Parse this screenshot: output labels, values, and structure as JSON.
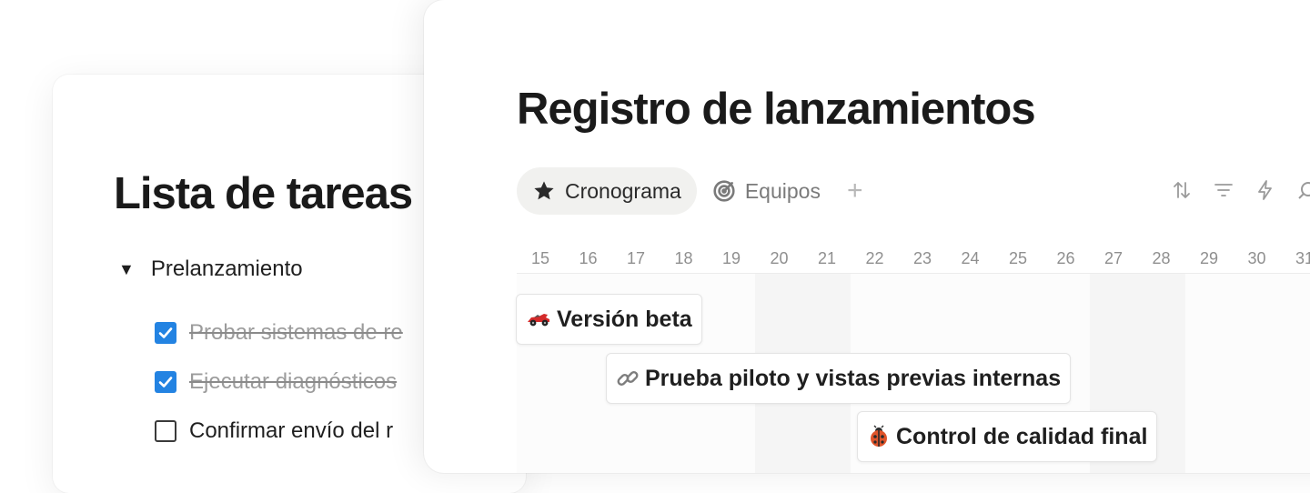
{
  "task_list": {
    "title": "Lista de tareas",
    "group": {
      "label": "Prelanzamiento",
      "expanded": true
    },
    "tasks": [
      {
        "text": "Probar sistemas de re",
        "checked": true
      },
      {
        "text": "Ejecutar diagnósticos",
        "checked": true
      },
      {
        "text": "Confirmar envío del r",
        "checked": false
      }
    ]
  },
  "release_log": {
    "title": "Registro de lanzamientos",
    "tabs": [
      {
        "label": "Cronograma",
        "icon": "star-icon",
        "active": true
      },
      {
        "label": "Equipos",
        "icon": "target-icon",
        "active": false
      }
    ],
    "add_view_label": "+",
    "toolbar_icons": [
      "sort-icon",
      "filter-icon",
      "automation-icon",
      "search-icon"
    ],
    "dates": [
      "15",
      "16",
      "17",
      "18",
      "19",
      "20",
      "21",
      "22",
      "23",
      "24",
      "25",
      "26",
      "27",
      "28",
      "29",
      "30",
      "31"
    ],
    "weekend_days": [
      "20",
      "21",
      "27",
      "28"
    ],
    "items": [
      {
        "label": "Versión beta",
        "icon": "race-car-icon",
        "start": "15",
        "end": "18"
      },
      {
        "label": "Prueba piloto y vistas previas internas",
        "icon": "link-icon",
        "start": "17",
        "end": "27"
      },
      {
        "label": "Control de calidad final",
        "icon": "ladybug-icon",
        "start": "22",
        "end": "28"
      }
    ]
  },
  "colors": {
    "checkbox_accent": "#2383e2",
    "active_tab_bg": "#f1f1ef",
    "weekend_shade": "#f5f5f5"
  }
}
